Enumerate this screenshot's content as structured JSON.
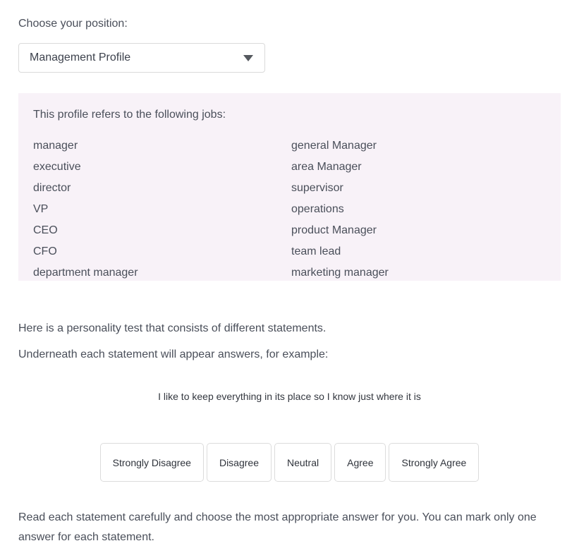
{
  "chooser": {
    "label": "Choose your position:",
    "selected_value": "Management Profile",
    "arrow_icon": "chevron-down-icon"
  },
  "jobs_panel": {
    "heading": "This profile refers to the following jobs:",
    "background_color": "#f8f2f8",
    "left_column": [
      "manager",
      "executive",
      "director",
      "VP",
      "CEO",
      "CFO",
      "department manager"
    ],
    "right_column": [
      "general Manager",
      "area Manager",
      "supervisor",
      "operations",
      "product Manager",
      "team lead",
      "marketing manager"
    ]
  },
  "intro": {
    "line_1": "Here is a personality test that consists of different statements.",
    "line_2": "Underneath each statement will appear answers, for example:"
  },
  "example": {
    "statement": "I like to keep everything in its place so I know just where it is",
    "answers": [
      "Strongly Disagree",
      "Disagree",
      "Neutral",
      "Agree",
      "Strongly Agree"
    ]
  },
  "closing": {
    "text": "Read each statement carefully and choose the most appropriate answer for you. You can mark only one answer for each statement."
  }
}
